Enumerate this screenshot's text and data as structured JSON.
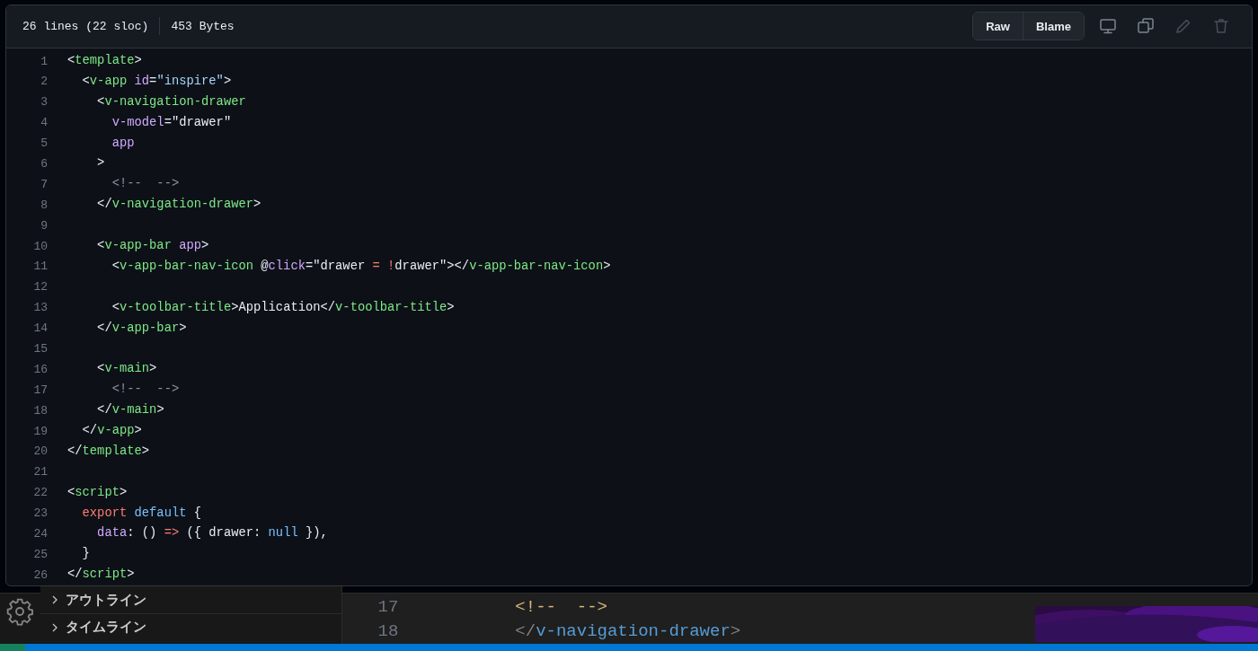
{
  "file_info": {
    "lines": "26 lines (22 sloc)",
    "size": "453 Bytes"
  },
  "buttons": [
    "Raw",
    "Blame"
  ],
  "icon_buttons": [
    {
      "kind": "display",
      "disabled": false
    },
    {
      "kind": "copy",
      "disabled": false
    },
    {
      "kind": "edit",
      "disabled": true
    },
    {
      "kind": "delete",
      "disabled": true
    }
  ],
  "code": [
    {
      "number": "1",
      "tokens": [
        {
          "kind": "punct",
          "text": "<"
        },
        {
          "kind": "tag",
          "text": "template"
        },
        {
          "kind": "punct",
          "text": ">"
        }
      ]
    },
    {
      "number": "2",
      "tokens": [
        {
          "kind": "punct",
          "text": "  <"
        },
        {
          "kind": "tag",
          "text": "v-app"
        },
        {
          "kind": "attr",
          "text": " id"
        },
        {
          "kind": "punct",
          "text": "="
        },
        {
          "kind": "string",
          "text": "\"inspire\""
        },
        {
          "kind": "punct",
          "text": ">"
        }
      ]
    },
    {
      "number": "3",
      "tokens": [
        {
          "kind": "punct",
          "text": "    <"
        },
        {
          "kind": "tag",
          "text": "v-navigation-drawer"
        }
      ]
    },
    {
      "number": "4",
      "tokens": [
        {
          "kind": "attr",
          "text": "      v-model"
        },
        {
          "kind": "punct",
          "text": "=\"drawer\""
        }
      ]
    },
    {
      "number": "5",
      "tokens": [
        {
          "kind": "attr",
          "text": "      app"
        }
      ]
    },
    {
      "number": "6",
      "tokens": [
        {
          "kind": "punct",
          "text": "    >"
        }
      ]
    },
    {
      "number": "7",
      "tokens": [
        {
          "kind": "comment",
          "text": "      <!--  -->"
        }
      ]
    },
    {
      "number": "8",
      "tokens": [
        {
          "kind": "punct",
          "text": "    </"
        },
        {
          "kind": "tag",
          "text": "v-navigation-drawer"
        },
        {
          "kind": "punct",
          "text": ">"
        }
      ]
    },
    {
      "number": "9"
    },
    {
      "number": "10",
      "tokens": [
        {
          "kind": "punct",
          "text": "    <"
        },
        {
          "kind": "tag",
          "text": "v-app-bar"
        },
        {
          "kind": "attr",
          "text": " app"
        },
        {
          "kind": "punct",
          "text": ">"
        }
      ]
    },
    {
      "number": "11",
      "tokens": [
        {
          "kind": "punct",
          "text": "      <"
        },
        {
          "kind": "tag",
          "text": "v-app-bar-nav-icon"
        },
        {
          "kind": "punct",
          "text": " @"
        },
        {
          "kind": "attr",
          "text": "click"
        },
        {
          "kind": "punct",
          "text": "=\"drawer "
        },
        {
          "kind": "keyword",
          "text": "= !"
        },
        {
          "kind": "punct",
          "text": "drawer\"></"
        },
        {
          "kind": "tag",
          "text": "v-app-bar-nav-icon"
        },
        {
          "kind": "punct",
          "text": ">"
        }
      ]
    },
    {
      "number": "12"
    },
    {
      "number": "13",
      "tokens": [
        {
          "kind": "punct",
          "text": "      <"
        },
        {
          "kind": "tag",
          "text": "v-toolbar-title"
        },
        {
          "kind": "punct",
          "text": ">Application</"
        },
        {
          "kind": "tag",
          "text": "v-toolbar-title"
        },
        {
          "kind": "punct",
          "text": ">"
        }
      ]
    },
    {
      "number": "14",
      "tokens": [
        {
          "kind": "punct",
          "text": "    </"
        },
        {
          "kind": "tag",
          "text": "v-app-bar"
        },
        {
          "kind": "punct",
          "text": ">"
        }
      ]
    },
    {
      "number": "15"
    },
    {
      "number": "16",
      "tokens": [
        {
          "kind": "punct",
          "text": "    <"
        },
        {
          "kind": "tag",
          "text": "v-main"
        },
        {
          "kind": "punct",
          "text": ">"
        }
      ]
    },
    {
      "number": "17",
      "tokens": [
        {
          "kind": "comment",
          "text": "      <!--  -->"
        }
      ]
    },
    {
      "number": "18",
      "tokens": [
        {
          "kind": "punct",
          "text": "    </"
        },
        {
          "kind": "tag",
          "text": "v-main"
        },
        {
          "kind": "punct",
          "text": ">"
        }
      ]
    },
    {
      "number": "19",
      "tokens": [
        {
          "kind": "punct",
          "text": "  </"
        },
        {
          "kind": "tag",
          "text": "v-app"
        },
        {
          "kind": "punct",
          "text": ">"
        }
      ]
    },
    {
      "number": "20",
      "tokens": [
        {
          "kind": "punct",
          "text": "</"
        },
        {
          "kind": "tag",
          "text": "template"
        },
        {
          "kind": "punct",
          "text": ">"
        }
      ]
    },
    {
      "number": "21"
    },
    {
      "number": "22",
      "tokens": [
        {
          "kind": "punct",
          "text": "<"
        },
        {
          "kind": "tag",
          "text": "script"
        },
        {
          "kind": "punct",
          "text": ">"
        }
      ]
    },
    {
      "number": "23",
      "tokens": [
        {
          "kind": "keyword",
          "text": "  export"
        },
        {
          "kind": "constant",
          "text": " default"
        },
        {
          "kind": "punct",
          "text": " {"
        }
      ]
    },
    {
      "number": "24",
      "tokens": [
        {
          "kind": "attr",
          "text": "    data"
        },
        {
          "kind": "punct",
          "text": ": () "
        },
        {
          "kind": "keyword",
          "text": "=>"
        },
        {
          "kind": "punct",
          "text": " ({ drawer: "
        },
        {
          "kind": "constant",
          "text": "null"
        },
        {
          "kind": "punct",
          "text": " }),"
        }
      ]
    },
    {
      "number": "25",
      "tokens": [
        {
          "kind": "punct",
          "text": "  }"
        }
      ]
    },
    {
      "number": "26",
      "tokens": [
        {
          "kind": "punct",
          "text": "</"
        },
        {
          "kind": "tag",
          "text": "script"
        },
        {
          "kind": "punct",
          "text": ">"
        }
      ]
    }
  ],
  "background_editor": {
    "sidebar_sections": [
      {
        "label": "アウトライン",
        "expanded": false
      },
      {
        "label": "タイムライン",
        "expanded": false
      }
    ],
    "lines": [
      {
        "number": "17",
        "tokens": [
          {
            "kind": "comment",
            "text": "<!--  -->"
          }
        ]
      },
      {
        "number": "18",
        "tokens": [
          {
            "kind": "punct",
            "text": "</"
          },
          {
            "kind": "tag",
            "text": "v-navigation-drawer"
          },
          {
            "kind": "punct",
            "text": ">"
          }
        ]
      }
    ]
  }
}
